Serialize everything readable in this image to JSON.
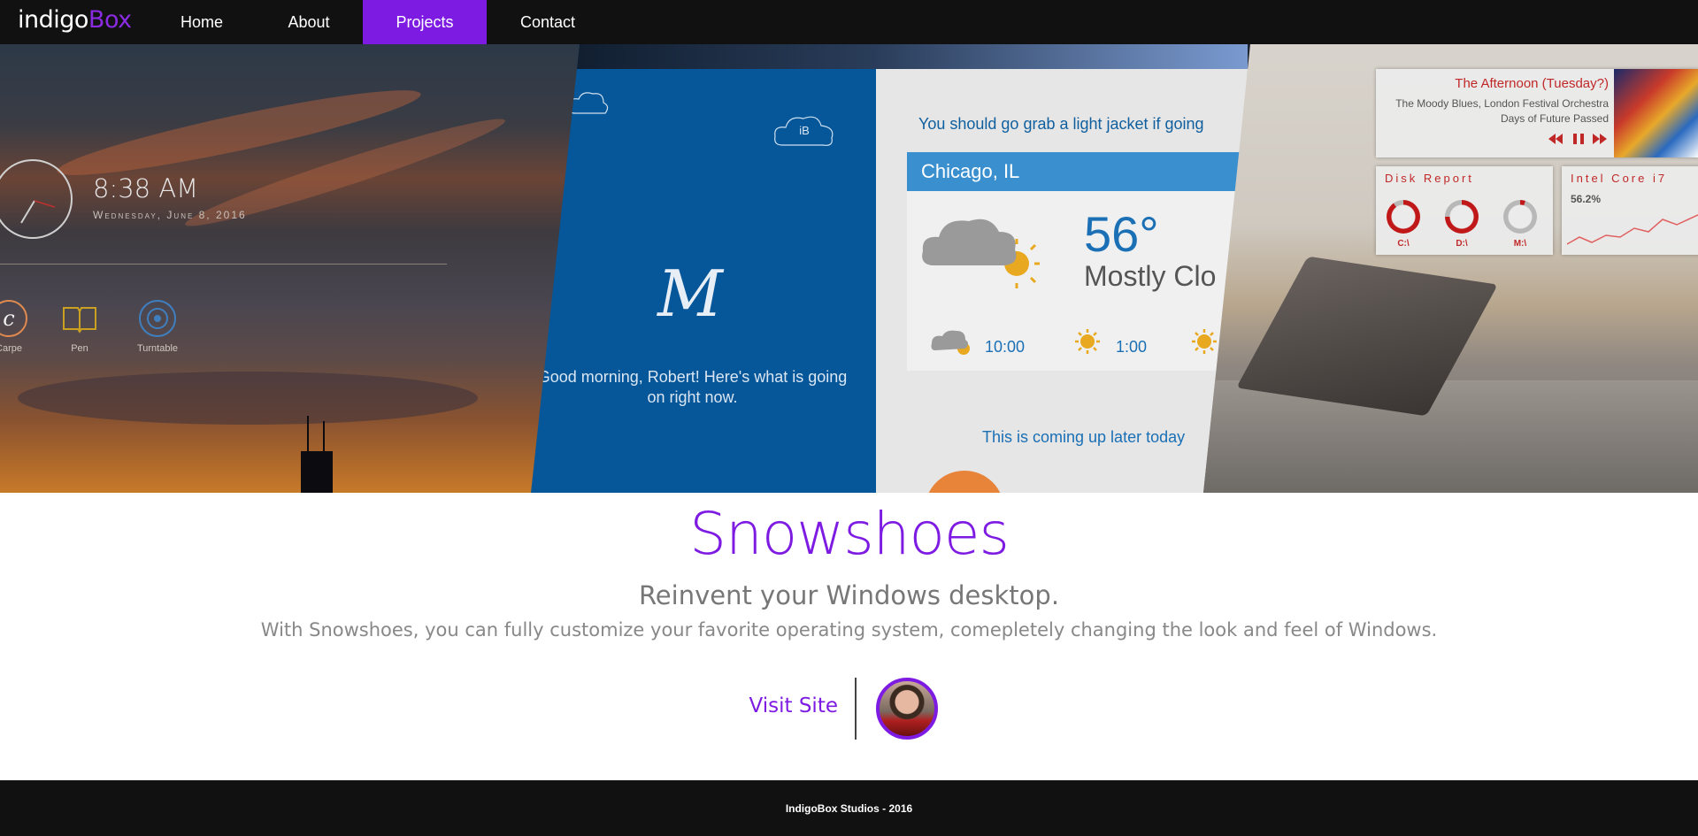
{
  "brand": {
    "part1": "indigo",
    "part2": "Box",
    "accent_color": "#8a2be2"
  },
  "nav": {
    "items": [
      {
        "label": "Home",
        "active": false
      },
      {
        "label": "About",
        "active": false
      },
      {
        "label": "Projects",
        "active": true
      },
      {
        "label": "Contact",
        "active": false
      }
    ],
    "active_color": "#7e1be3"
  },
  "hero": {
    "panel_clock": {
      "time": "8:38 AM",
      "date": "Wednesday, June 8, 2016",
      "apps": [
        {
          "label": "Carpe",
          "icon": "carpe-icon"
        },
        {
          "label": "Pen",
          "icon": "pen-book-icon"
        },
        {
          "label": "Turntable",
          "icon": "turntable-icon"
        }
      ]
    },
    "panel_greeting": {
      "cloud_label": "iB",
      "logo_letter": "M",
      "message": "Good morning, Robert! Here's what is going on right now."
    },
    "panel_weather": {
      "advice": "You should go grab a light jacket if going",
      "city": "Chicago, IL",
      "temperature": "56°",
      "condition": "Mostly Clo",
      "hours": [
        "10:00",
        "1:00"
      ],
      "upcoming": "This is coming up later today"
    },
    "panel_desktop": {
      "music": {
        "title": "The Afternoon (Tuesday?)",
        "artist": "The Moody Blues, London Festival Orchestra",
        "album": "Days of Future Passed"
      },
      "disk_report": {
        "title": "Disk Report",
        "drives": [
          {
            "label": "C:\\",
            "fill": 0.9
          },
          {
            "label": "D:\\",
            "fill": 0.75
          },
          {
            "label": "M:\\",
            "fill": 0.05
          }
        ]
      },
      "cpu": {
        "title": "Intel Core i7",
        "value": "56.2%"
      }
    }
  },
  "project": {
    "title": "Snowshoes",
    "subtitle": "Reinvent your Windows desktop.",
    "description": "With Snowshoes, you can fully customize your favorite operating system, comepletely changing the look and feel of Windows.",
    "visit_label": "Visit Site"
  },
  "footer": {
    "text": "IndigoBox Studios - 2016"
  }
}
